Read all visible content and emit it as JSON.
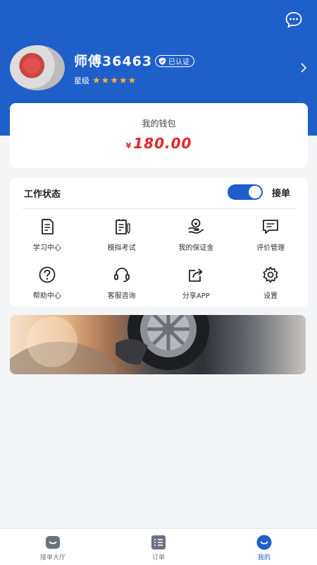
{
  "header": {
    "name": "师傅36463",
    "verified": "已认证",
    "level_label": "星级",
    "star_count": 5
  },
  "wallet": {
    "title": "我的钱包",
    "currency": "¥",
    "amount": "180.00"
  },
  "work": {
    "status_label": "工作状态",
    "toggle_on": true,
    "toggle_text": "接单"
  },
  "menu": [
    {
      "label": "学习中心",
      "icon": "book-icon"
    },
    {
      "label": "模拟考试",
      "icon": "exam-icon"
    },
    {
      "label": "我的保证金",
      "icon": "deposit-icon"
    },
    {
      "label": "评价管理",
      "icon": "review-icon"
    },
    {
      "label": "帮助中心",
      "icon": "help-icon"
    },
    {
      "label": "客服咨询",
      "icon": "headset-icon"
    },
    {
      "label": "分享APP",
      "icon": "share-icon"
    },
    {
      "label": "设置",
      "icon": "gear-icon"
    }
  ],
  "tabs": [
    {
      "label": "接单大厅",
      "icon": "hall-icon"
    },
    {
      "label": "订单",
      "icon": "orders-icon"
    },
    {
      "label": "我的",
      "icon": "profile-icon"
    }
  ],
  "colors": {
    "primary": "#1f5fc9",
    "amount": "#e3262a",
    "star": "#ffb02e"
  }
}
